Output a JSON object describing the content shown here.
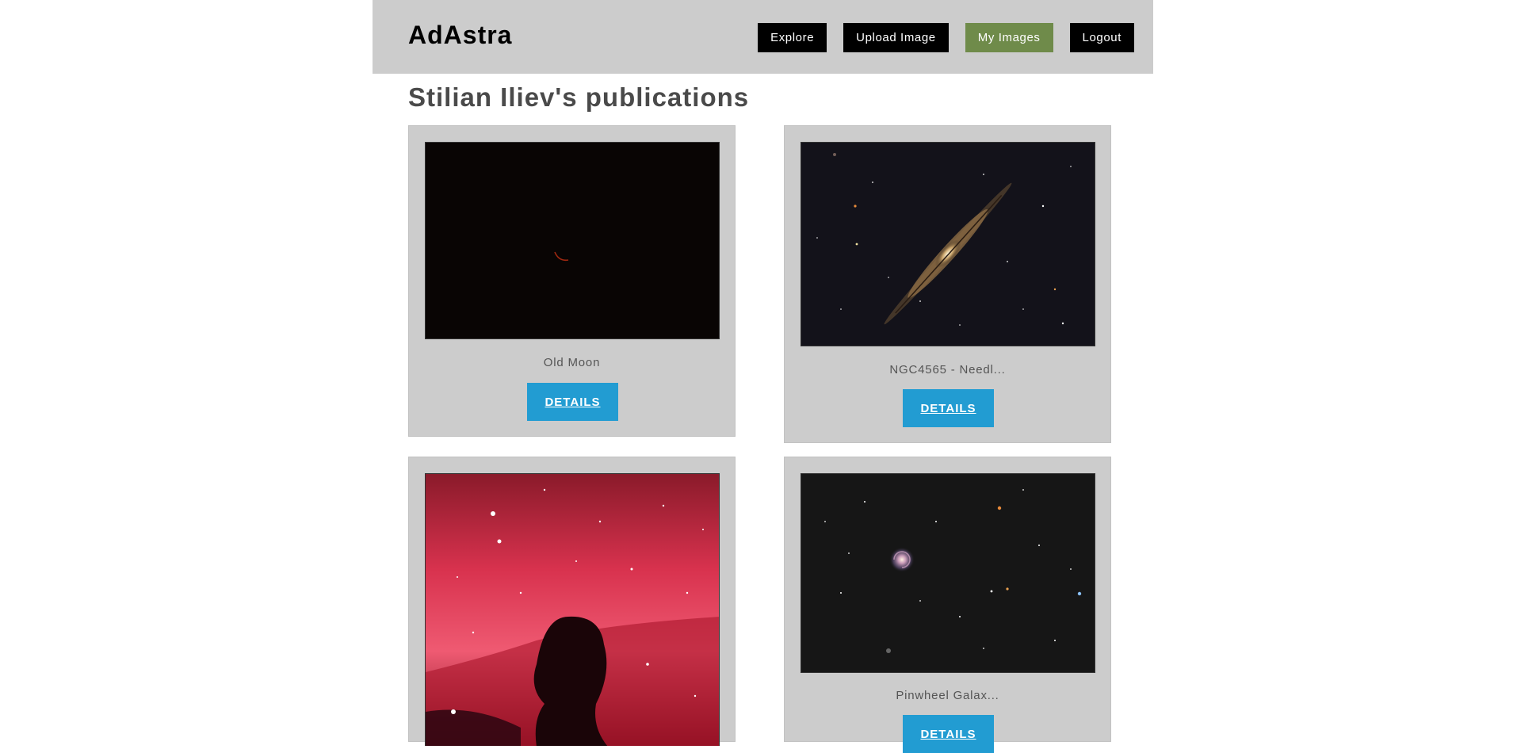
{
  "header": {
    "logo": "AdAstra",
    "nav": [
      {
        "label": "Explore",
        "active": false
      },
      {
        "label": "Upload Image",
        "active": false
      },
      {
        "label": "My Images",
        "active": true
      },
      {
        "label": "Logout",
        "active": false
      }
    ]
  },
  "page": {
    "title": "Stilian Iliev's publications"
  },
  "publications": [
    {
      "title": "Old Moon",
      "button": "DETAILS",
      "image": "moon-crescent-photo"
    },
    {
      "title": "NGC4565 - Needl...",
      "button": "DETAILS",
      "image": "needle-galaxy-photo"
    },
    {
      "title": "",
      "button": "",
      "image": "horsehead-nebula-photo"
    },
    {
      "title": "Pinwheel Galax...",
      "button": "DETAILS",
      "image": "pinwheel-galaxy-photo"
    }
  ],
  "colors": {
    "header_bg": "#cccccc",
    "nav_button": "#000000",
    "nav_active": "#6f8b4a",
    "details_button": "#229cd2",
    "card_bg": "#cccccc"
  }
}
